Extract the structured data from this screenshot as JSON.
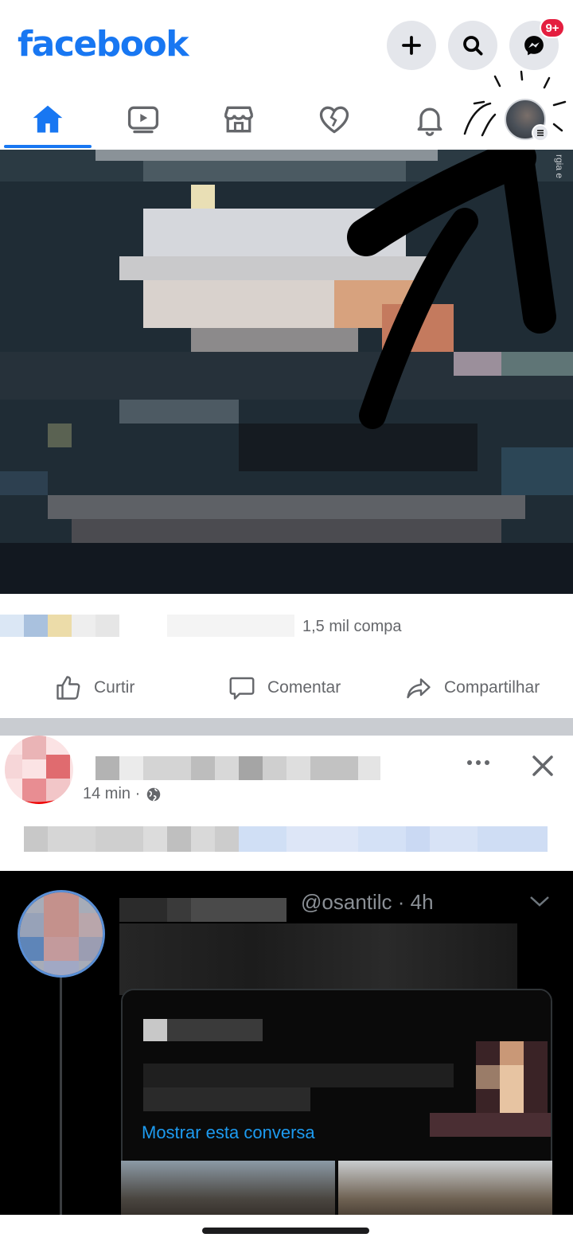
{
  "header": {
    "logo": "facebook",
    "create_icon": "plus-icon",
    "search_icon": "search-icon",
    "messenger_icon": "messenger-icon",
    "messenger_badge": "9+",
    "brand_color": "#1877f2",
    "badge_color": "#e41e3f"
  },
  "tabs": [
    {
      "name": "home",
      "icon": "home-icon",
      "active": true
    },
    {
      "name": "watch",
      "icon": "video-icon",
      "active": false
    },
    {
      "name": "marketplace",
      "icon": "store-icon",
      "active": false
    },
    {
      "name": "dating",
      "icon": "heart-icon",
      "active": false
    },
    {
      "name": "notifications",
      "icon": "bell-icon",
      "active": false
    },
    {
      "name": "menu",
      "icon": "profile-avatar",
      "active": false
    }
  ],
  "post1": {
    "side_text": "rgia e",
    "stats": "1,5 mil compa"
  },
  "actions": {
    "like": "Curtir",
    "comment": "Comentar",
    "share": "Compartilhar"
  },
  "post2": {
    "time": "14 min ·",
    "privacy_icon": "globe-icon",
    "more_icon": "more-dots-icon",
    "close_icon": "close-icon"
  },
  "tweet": {
    "handle": "@osantilc · 4h",
    "show_thread": "Mostrar esta conversa",
    "link_color": "#1d9bf0"
  }
}
